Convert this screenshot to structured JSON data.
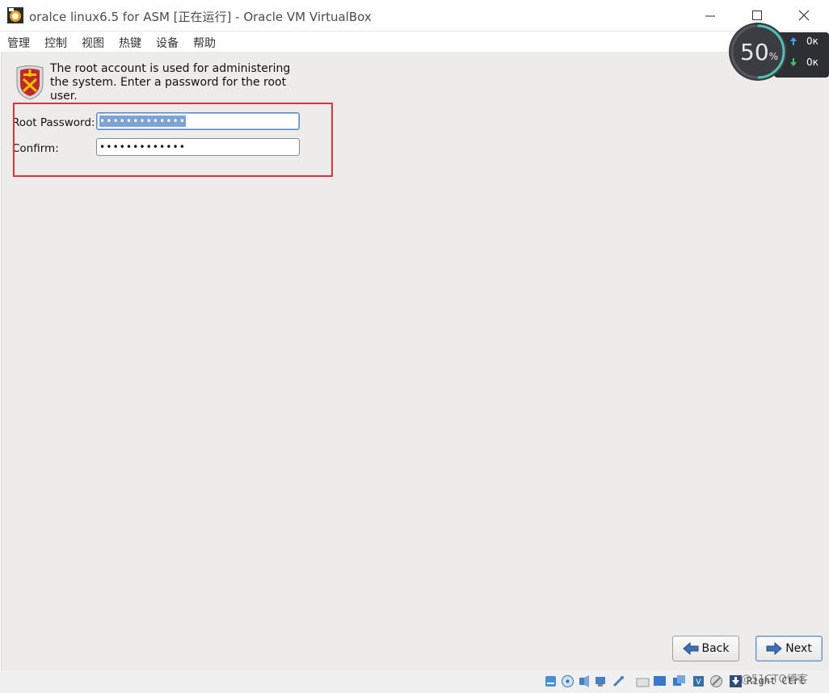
{
  "window": {
    "title": "oralce linux6.5 for ASM [正在运行] - Oracle VM VirtualBox",
    "minimize_icon": "minimize-icon",
    "maximize_icon": "maximize-icon",
    "close_icon": "close-icon"
  },
  "menu": {
    "items": [
      {
        "label": "管理"
      },
      {
        "label": "控制"
      },
      {
        "label": "视图"
      },
      {
        "label": "热键"
      },
      {
        "label": "设备"
      },
      {
        "label": "帮助"
      }
    ]
  },
  "perf_widget": {
    "cpu_percent": "50",
    "percent_sign": "%",
    "upload_rate": "0к",
    "download_rate": "0к"
  },
  "installer": {
    "description": "The root account is used for administering the system.  Enter a password for the root user.",
    "root_password_label": "Root Password:",
    "root_password_value": "•••••••••••••",
    "confirm_label": "Confirm:",
    "confirm_value": "•••••••••••••",
    "back_label": "Back",
    "next_label": "Next"
  },
  "statusbar": {
    "host_key": "Right Ctrl",
    "watermark": "@51CTO博客"
  },
  "colors": {
    "highlight": "#e0323b",
    "selection": "#7da2d4",
    "guest_bg": "#edecea"
  }
}
